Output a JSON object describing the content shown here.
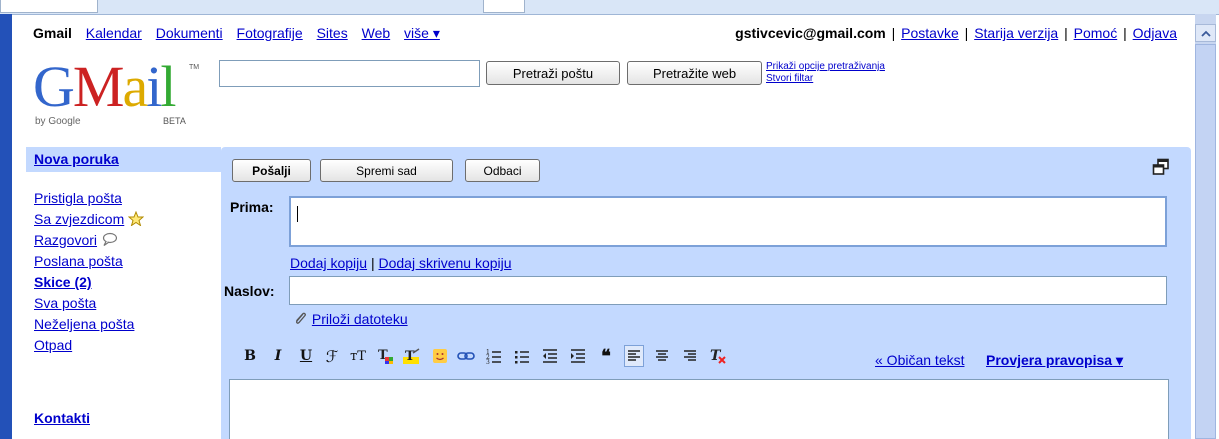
{
  "topnav": {
    "brand": "Gmail",
    "links": [
      "Kalendar",
      "Dokumenti",
      "Fotografije",
      "Sites",
      "Web"
    ],
    "more": "više ▾"
  },
  "user": {
    "email": "gstivcevic@gmail.com",
    "links": [
      "Postavke",
      "Starija verzija",
      "Pomoć",
      "Odjava"
    ]
  },
  "logo": {
    "text": "Gmail",
    "by": "by Google",
    "beta": "BETA",
    "tm": "TM"
  },
  "search": {
    "value": "",
    "mail_button": "Pretraži poštu",
    "web_button": "Pretražite web",
    "options_link": "Prikaži opcije pretraživanja",
    "filter_link": "Stvori filtar"
  },
  "sidebar": {
    "compose": "Nova poruka",
    "items": [
      {
        "label": "Pristigla pošta",
        "icon": ""
      },
      {
        "label": "Sa zvjezdicom",
        "icon": "star-icon"
      },
      {
        "label": "Razgovori",
        "icon": "chat-bubble-icon"
      },
      {
        "label": "Poslana pošta",
        "icon": ""
      },
      {
        "label": "Skice (2)",
        "icon": ""
      },
      {
        "label": "Sva pošta",
        "icon": ""
      },
      {
        "label": "Neželjena pošta",
        "icon": ""
      },
      {
        "label": "Otpad",
        "icon": ""
      }
    ],
    "contacts": "Kontakti"
  },
  "compose": {
    "send": "Pošalji",
    "save": "Spremi sad",
    "discard": "Odbaci",
    "to_label": "Prima:",
    "to_value": "",
    "cc_link": "Dodaj kopiju",
    "bcc_link": "Dodaj skrivenu kopiju",
    "separator": "|",
    "subject_label": "Naslov:",
    "subject_value": "",
    "attach": "Priloži datoteku",
    "plain_text": "« Običan tekst",
    "spellcheck": "Provjera pravopisa ▾",
    "body": ""
  },
  "toolbar_icons": [
    "bold-icon",
    "italic-icon",
    "underline-icon",
    "font-icon",
    "font-size-icon",
    "text-color-icon",
    "highlight-icon",
    "emoticon-icon",
    "link-icon",
    "numbered-list-icon",
    "bullet-list-icon",
    "outdent-icon",
    "indent-icon",
    "quote-icon",
    "align-left-icon",
    "align-center-icon",
    "align-right-icon",
    "remove-formatting-icon"
  ],
  "toolbar_glyphs": [
    "B",
    "I",
    "U",
    "ℱ",
    "тT",
    "T",
    "T",
    "☺",
    "⊖",
    "☰",
    "☰",
    "⇤",
    "⇥",
    "❝",
    "≡",
    "≡",
    "≡",
    "T"
  ],
  "colors": {
    "accent": "#c3d9ff",
    "link": "#0000cc",
    "frame": "#2351b8"
  }
}
